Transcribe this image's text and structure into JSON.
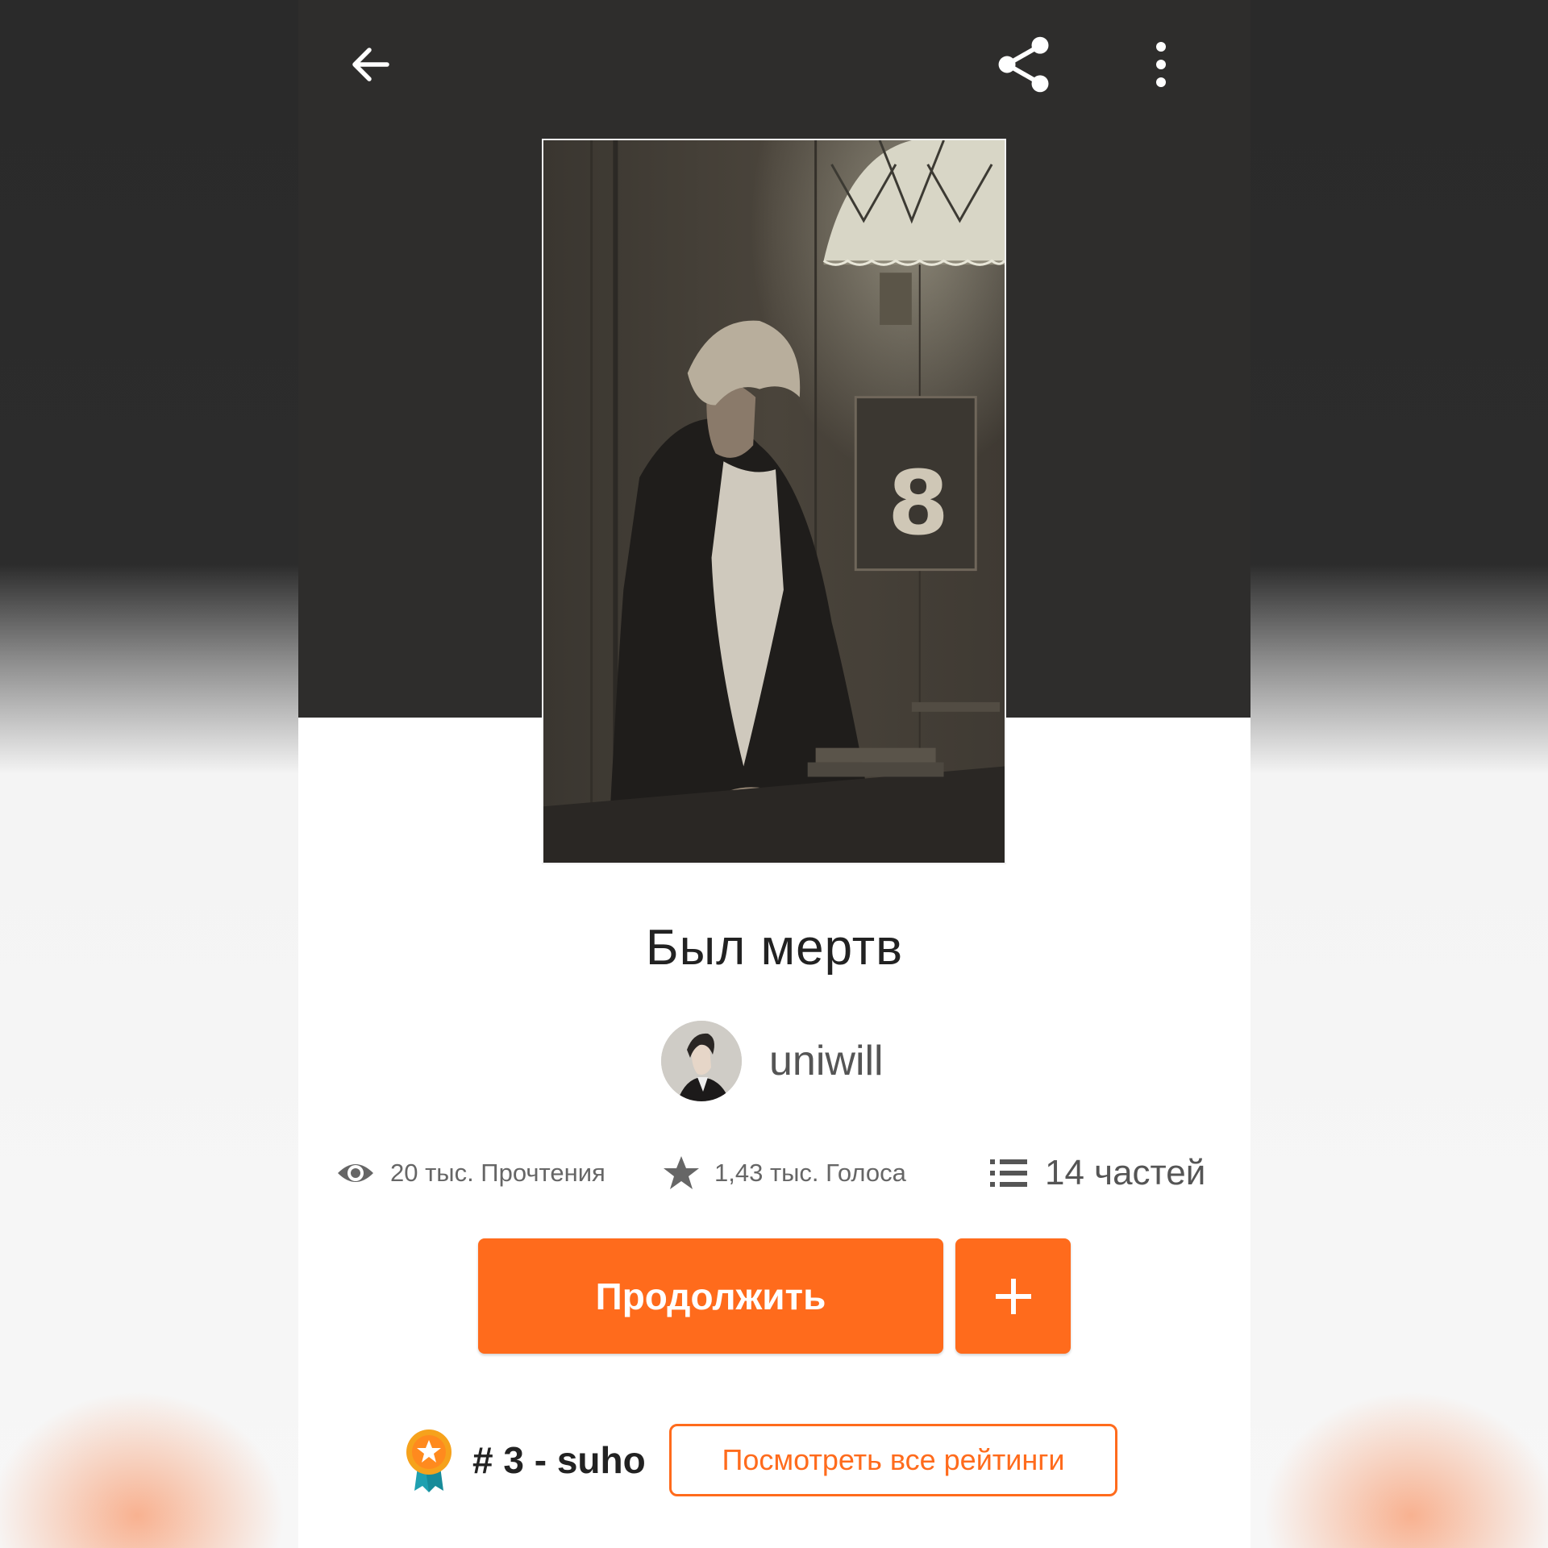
{
  "toolbar": {
    "back_icon": "arrow-left-icon",
    "share_icon": "share-icon",
    "more_icon": "more-vertical-icon"
  },
  "story": {
    "title": "Был мертв",
    "author": "uniwill"
  },
  "stats": {
    "reads": "20 тыс. Прочтения",
    "votes": "1,43 тыс. Голоса",
    "parts": "14 частей"
  },
  "actions": {
    "continue_label": "Продолжить",
    "add_icon": "plus-icon"
  },
  "ranking": {
    "rank": "# 3 - suho",
    "view_all_label": "Посмотреть все рейтинги"
  },
  "colors": {
    "accent": "#ff6b1c",
    "hero_bg": "#2e2d2c"
  }
}
